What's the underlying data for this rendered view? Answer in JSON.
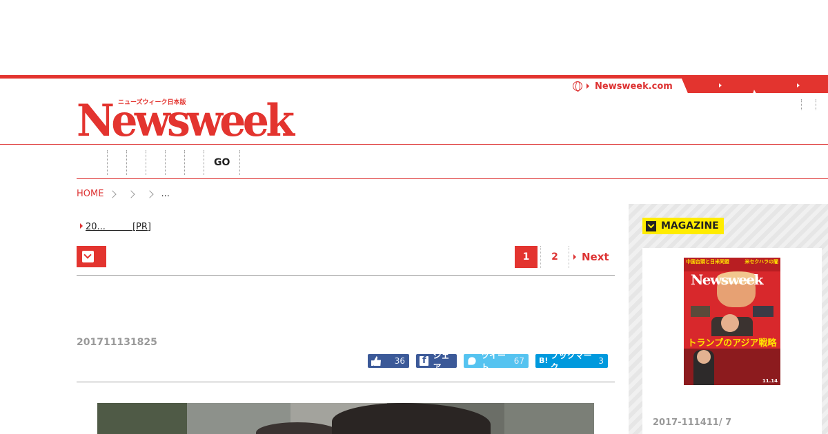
{
  "header": {
    "logo_sub": "ニューズウィーク日本版",
    "logo": "Newsweek",
    "intl_link": "Newsweek.com",
    "colors": {
      "brand": "#e3342f",
      "accent_yellow": "#ffec00"
    }
  },
  "nav": {
    "go_label": "GO",
    "item_count": 6
  },
  "breadcrumb": {
    "home": "HOME",
    "ellipsis": "..."
  },
  "pr": {
    "link": "20...　　　[PR]"
  },
  "pager": {
    "current": "1",
    "page2": "2",
    "next": "Next"
  },
  "article": {
    "date": "201711131825"
  },
  "social": {
    "like_count": "36",
    "share_label": "シェア",
    "tweet_label": "ツイート",
    "tweet_count": "67",
    "hatena_icon": "B!",
    "hatena_label": "ブックマーク",
    "hatena_count": "3"
  },
  "sidebar": {
    "magazine_label": "MAGAZINE",
    "cover": {
      "top_left": "中国台頭と日米同盟",
      "top_right": "米セクハラの闇",
      "logo": "Newsweek",
      "title": "トランプのアジア戦略",
      "issue_date": "11.14"
    },
    "issue_date": "2017-111411/ 7"
  }
}
